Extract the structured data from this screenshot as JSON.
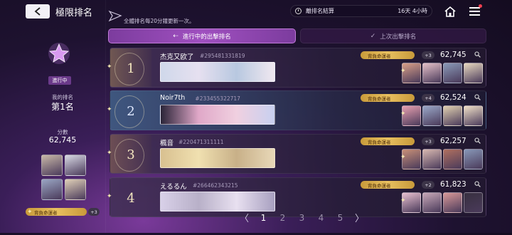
{
  "header": {
    "title": "極限排名",
    "notice": "全體排名每20分鐘更新一次。",
    "settlement_label": "離排名結算",
    "settlement_time": "16天 4小時"
  },
  "tabs": [
    {
      "label": "進行中的出擊排名",
      "active": true
    },
    {
      "label": "上次出擊排名",
      "active": false
    }
  ],
  "sidebar": {
    "status": "進行中",
    "rank_label": "我的排名",
    "rank_value": "第1名",
    "score_label": "分數",
    "score_value": "62,745",
    "mission_label": "背負命運者",
    "mission_extra": "+3",
    "char_colors": [
      "#c9b8a8",
      "#d8d8e4",
      "#9aa6c4",
      "#e0d0b8"
    ]
  },
  "rows": [
    {
      "rank": "1",
      "name": "杰克又欧了",
      "id": "#295481331819",
      "mission": "背負命運者",
      "plus": "+3",
      "score": "62,745",
      "banner": [
        "#cfd8ea",
        "#e6e0f0",
        "#b8c8e0",
        "#f0e8f0"
      ],
      "chars": [
        "#d9a088",
        "#e4c0c8",
        "#8a9ab8",
        "#e8d8c0"
      ]
    },
    {
      "rank": "2",
      "name": "Noir7th",
      "id": "#233455322717",
      "mission": "背負命運者",
      "plus": "+4",
      "score": "62,524",
      "banner": [
        "#2a2438",
        "#e0a8c8",
        "#f0d0e0",
        "#c8d0f0"
      ],
      "chars": [
        "#e8a0b0",
        "#9aa8c8",
        "#e0d0b0",
        "#f0e0c8"
      ]
    },
    {
      "rank": "3",
      "name": "楓音",
      "id": "#220471311111",
      "mission": "背負命運者",
      "plus": "+3",
      "score": "62,257",
      "banner": [
        "#d8c090",
        "#f0e0b0",
        "#c8b088",
        "#e8d8b8"
      ],
      "chars": [
        "#c89078",
        "#d8b8b0",
        "#b07060",
        "#8898b8"
      ]
    },
    {
      "rank": "4",
      "name": "えるるん",
      "id": "#266462343215",
      "mission": "背負命運者",
      "plus": "+2",
      "score": "61,823",
      "banner": [
        "#d8d0e8",
        "#b8b0c8",
        "#e8e0f0",
        "#a8a0c0"
      ],
      "chars": [
        "#e8c0d0",
        "#c8a8b8",
        "#d89898",
        "#383040"
      ]
    }
  ],
  "pagination": {
    "prev": "〈",
    "next": "〉",
    "pages": [
      "1",
      "2",
      "3",
      "4",
      "5"
    ],
    "current": "1"
  }
}
